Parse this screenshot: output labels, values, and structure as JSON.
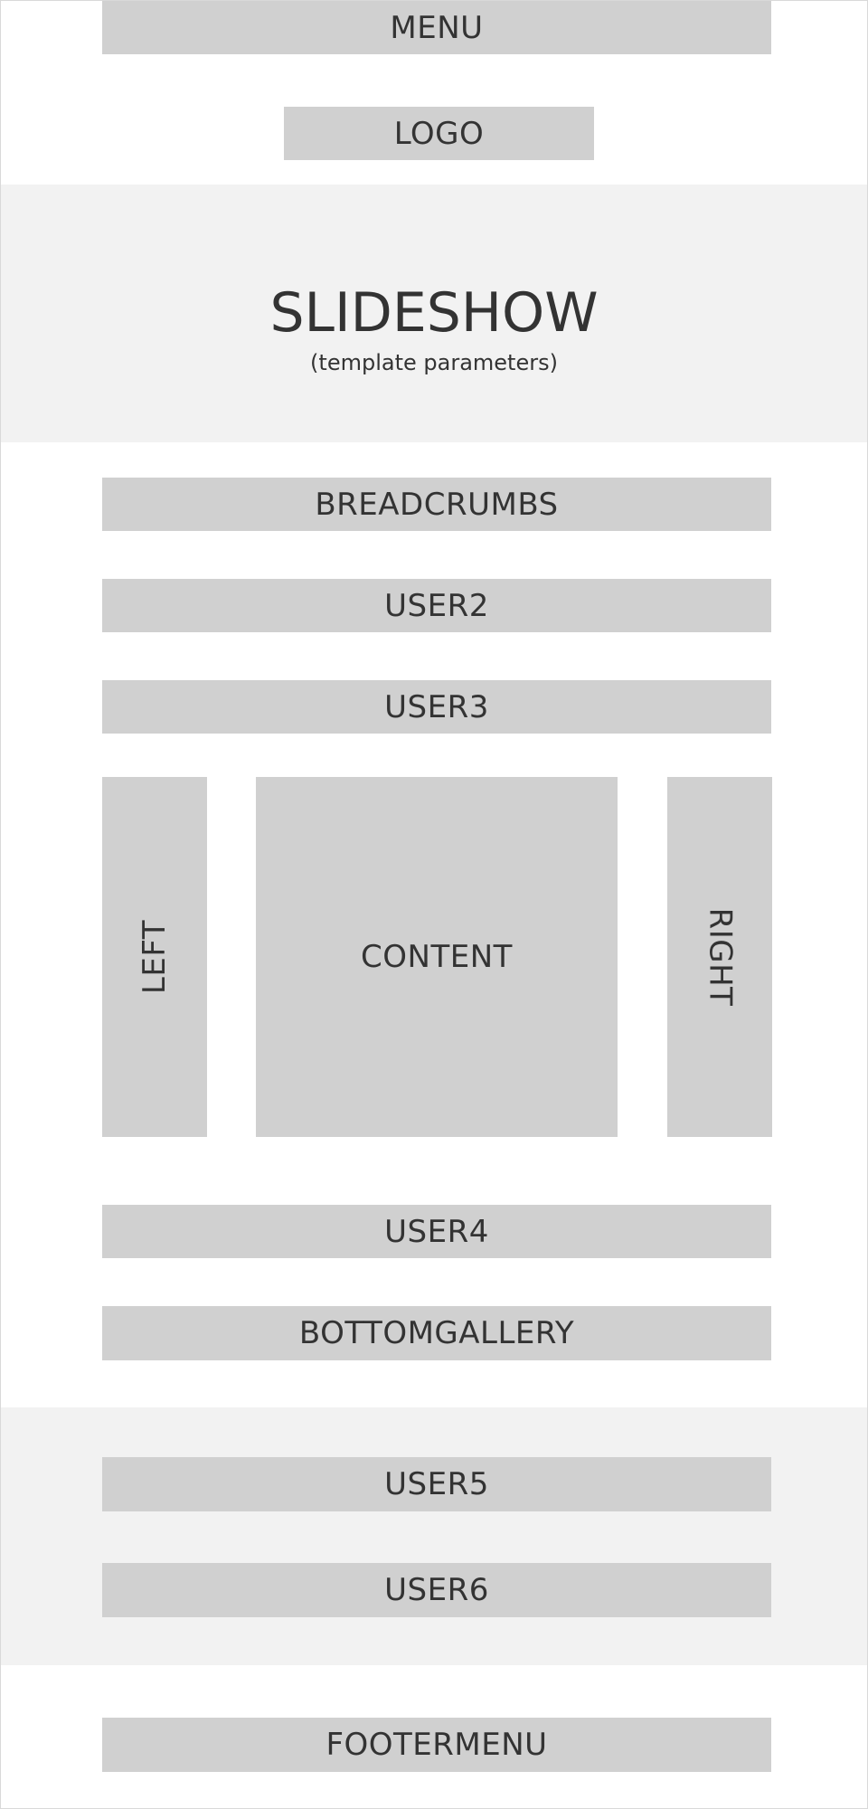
{
  "layout_labels": {
    "menu": "MENU",
    "logo": "LOGO",
    "slideshow_title": "SLIDESHOW",
    "slideshow_subtitle": "(template parameters)",
    "breadcrumbs": "BREADCRUMBS",
    "user2": "USER2",
    "user3": "USER3",
    "left": "LEFT",
    "content": "CONTENT",
    "right": "RIGHT",
    "user4": "USER4",
    "bottomgallery": "BOTTOMGALLERY",
    "user5": "USER5",
    "user6": "USER6",
    "footermenu": "FOOTERMENU"
  },
  "colors": {
    "block": "#d0d0d0",
    "band": "#f2f2f2",
    "text": "#333333",
    "background": "#ffffff"
  }
}
